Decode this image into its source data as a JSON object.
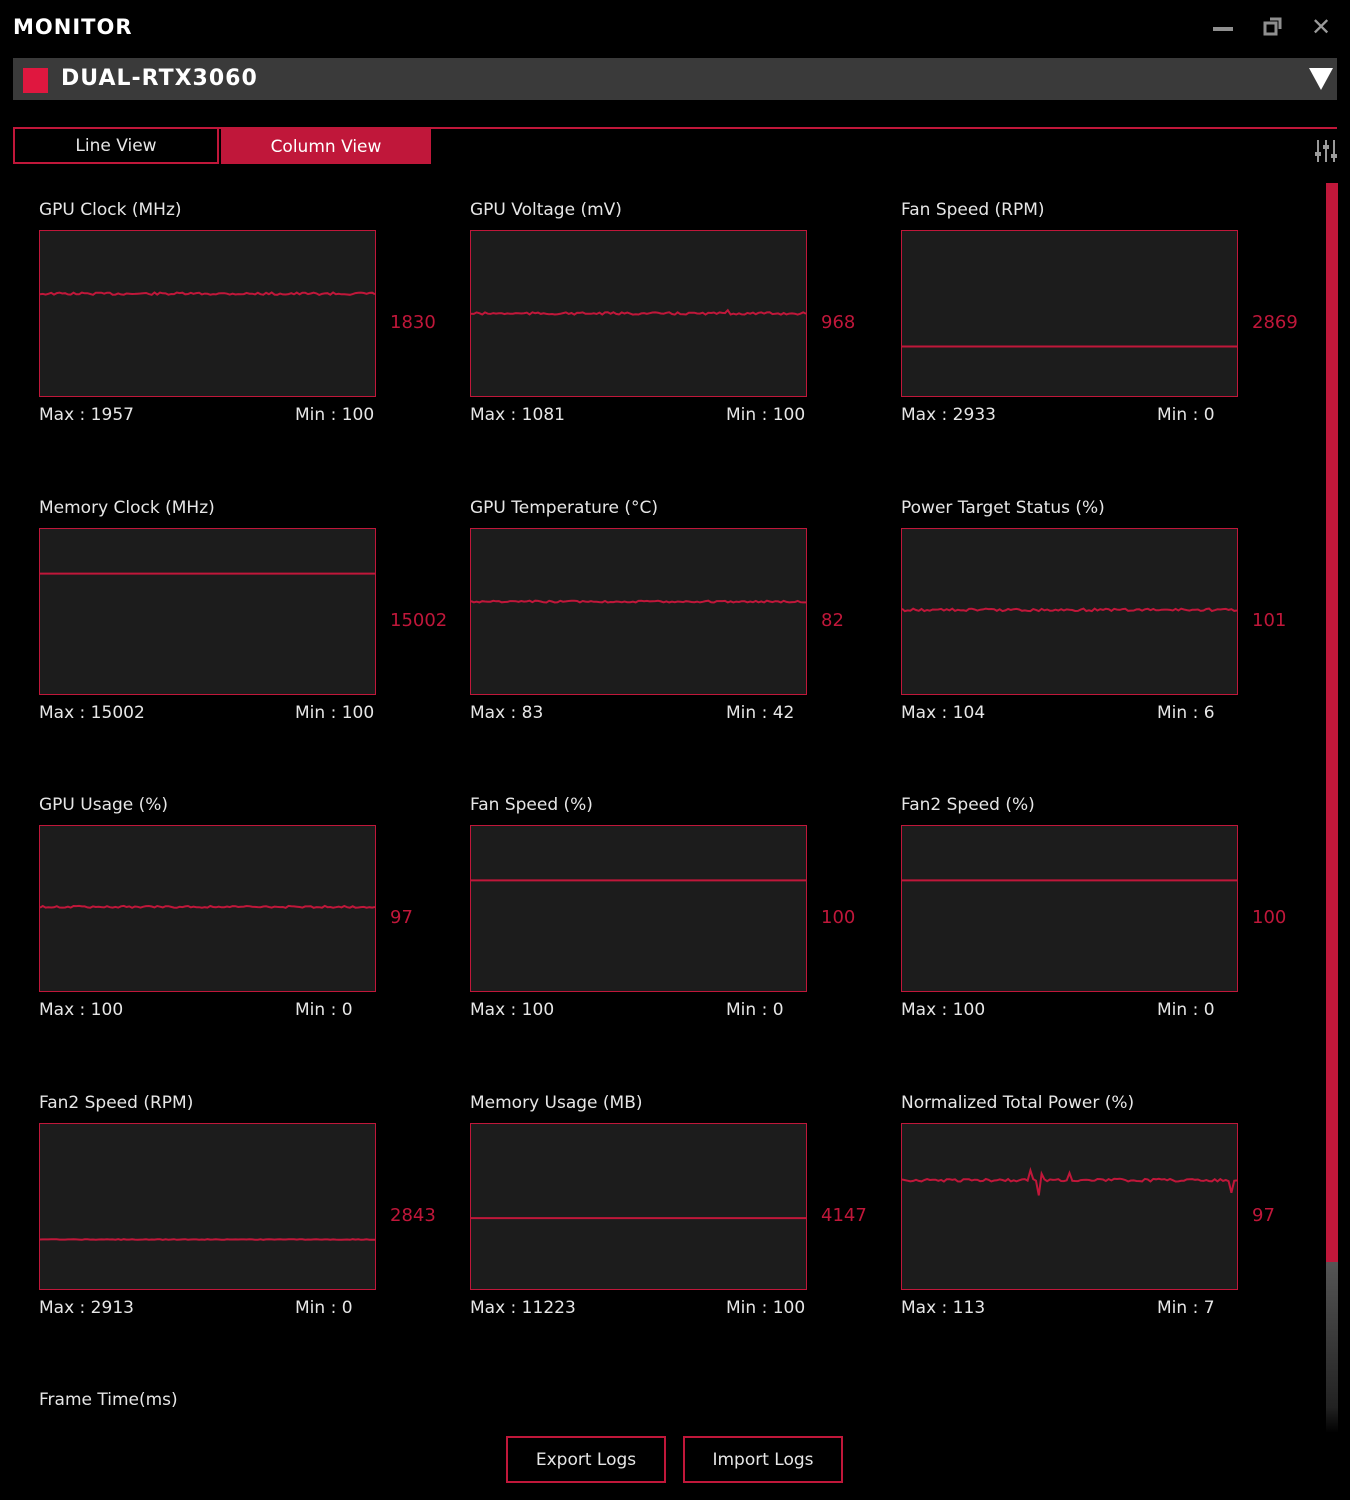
{
  "app": {
    "title": "MONITOR"
  },
  "device": {
    "name": "DUAL-RTX3060"
  },
  "tabs": {
    "line_view": "Line View",
    "column_view": "Column View"
  },
  "colors": {
    "accent": "#c0173a",
    "plot_bg": "#1c1c1c",
    "background": "#000000"
  },
  "cards": [
    {
      "title": "GPU Clock (MHz)",
      "current": "1830",
      "max": "Max : 1957",
      "min": "Min : 100",
      "level": 0.62,
      "noise": 1.2,
      "spikes": []
    },
    {
      "title": "GPU Voltage (mV)",
      "current": "968",
      "max": "Max : 1081",
      "min": "Min : 100",
      "level": 0.5,
      "noise": 1.2,
      "spikes": [
        [
          0.77,
          -4
        ]
      ]
    },
    {
      "title": "Fan Speed (RPM)",
      "current": "2869",
      "max": "Max : 2933",
      "min": "Min : 0",
      "level": 0.3,
      "noise": 0,
      "spikes": []
    },
    {
      "title": "Memory Clock (MHz)",
      "current": "15002",
      "max": "Max : 15002",
      "min": "Min : 100",
      "level": 0.73,
      "noise": 0,
      "spikes": []
    },
    {
      "title": "GPU Temperature (°C)",
      "current": "82",
      "max": "Max : 83",
      "min": "Min : 42",
      "level": 0.56,
      "noise": 0.9,
      "spikes": []
    },
    {
      "title": "Power Target Status (%)",
      "current": "101",
      "max": "Max : 104",
      "min": "Min : 6",
      "level": 0.51,
      "noise": 1.3,
      "spikes": []
    },
    {
      "title": "GPU Usage (%)",
      "current": "97",
      "max": "Max : 100",
      "min": "Min : 0",
      "level": 0.51,
      "noise": 1.0,
      "spikes": []
    },
    {
      "title": "Fan Speed (%)",
      "current": "100",
      "max": "Max : 100",
      "min": "Min : 0",
      "level": 0.67,
      "noise": 0,
      "spikes": []
    },
    {
      "title": "Fan2 Speed (%)",
      "current": "100",
      "max": "Max : 100",
      "min": "Min : 0",
      "level": 0.67,
      "noise": 0,
      "spikes": []
    },
    {
      "title": "Fan2 Speed (RPM)",
      "current": "2843",
      "max": "Max : 2913",
      "min": "Min : 0",
      "level": 0.3,
      "noise": 0.3,
      "spikes": []
    },
    {
      "title": "Memory Usage (MB)",
      "current": "4147",
      "max": "Max : 11223",
      "min": "Min : 100",
      "level": 0.43,
      "noise": 0,
      "spikes": []
    },
    {
      "title": "Normalized Total Power (%)",
      "current": "97",
      "max": "Max : 113",
      "min": "Min : 7",
      "level": 0.66,
      "noise": 1.4,
      "spikes": [
        [
          0.38,
          -9
        ],
        [
          0.41,
          14
        ],
        [
          0.42,
          -6
        ],
        [
          0.5,
          -8
        ],
        [
          0.98,
          12
        ]
      ]
    }
  ],
  "frame_time": {
    "title": "Frame Time(ms)"
  },
  "buttons": {
    "export": "Export Logs",
    "import": "Import Logs"
  }
}
